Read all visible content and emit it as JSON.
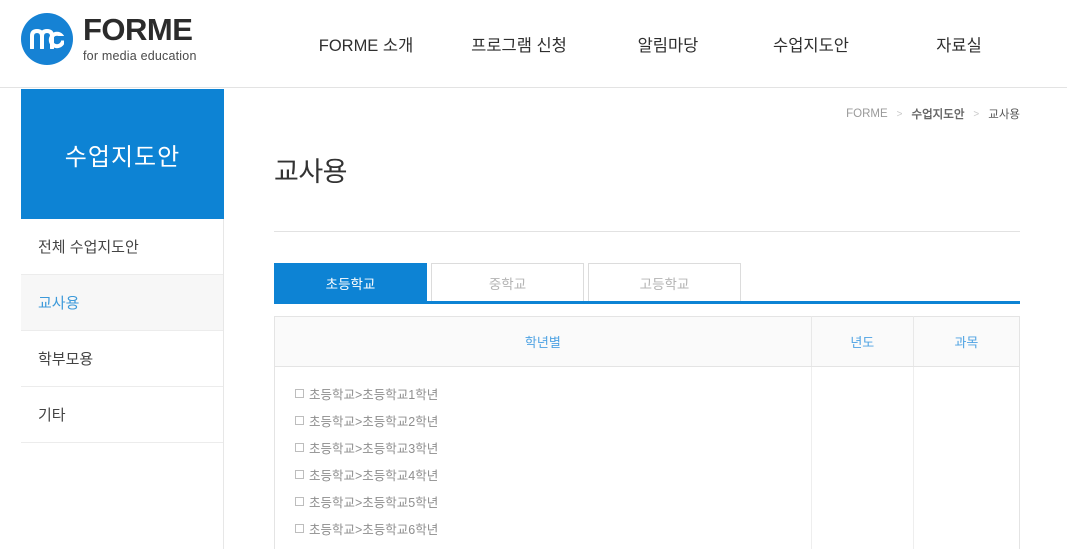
{
  "brand": {
    "mark_text": "me",
    "name": "FORME",
    "tagline": "for media education"
  },
  "nav": {
    "items": [
      {
        "label": "FORME 소개"
      },
      {
        "label": "프로그램 신청"
      },
      {
        "label": "알림마당"
      },
      {
        "label": "수업지도안"
      },
      {
        "label": "자료실"
      }
    ]
  },
  "sidebar": {
    "title": "수업지도안",
    "items": [
      {
        "label": "전체 수업지도안",
        "active": false
      },
      {
        "label": "교사용",
        "active": true
      },
      {
        "label": "학부모용",
        "active": false
      },
      {
        "label": "기타",
        "active": false
      }
    ]
  },
  "breadcrumb": {
    "separator": ">",
    "items": [
      {
        "label": "FORME"
      },
      {
        "label": "수업지도안"
      },
      {
        "label": "교사용"
      }
    ]
  },
  "main": {
    "page_title": "교사용",
    "tabs": [
      {
        "label": "초등학교",
        "active": true
      },
      {
        "label": "중학교",
        "active": false
      },
      {
        "label": "고등학교",
        "active": false
      }
    ],
    "table": {
      "headers": [
        "학년별",
        "년도",
        "과목"
      ],
      "grade_options": [
        {
          "label": "초등학교>초등학교1학년",
          "checked": false
        },
        {
          "label": "초등학교>초등학교2학년",
          "checked": false
        },
        {
          "label": "초등학교>초등학교3학년",
          "checked": false
        },
        {
          "label": "초등학교>초등학교4학년",
          "checked": false
        },
        {
          "label": "초등학교>초등학교5학년",
          "checked": false
        },
        {
          "label": "초등학교>초등학교6학년",
          "checked": false
        }
      ],
      "year_options": [],
      "subject_options": []
    }
  },
  "colors": {
    "brand_blue": "#1682d4",
    "accent_blue": "#0d83d4",
    "header_text_blue": "#4fa3e3",
    "active_sidebar_text": "#3d9ada"
  }
}
